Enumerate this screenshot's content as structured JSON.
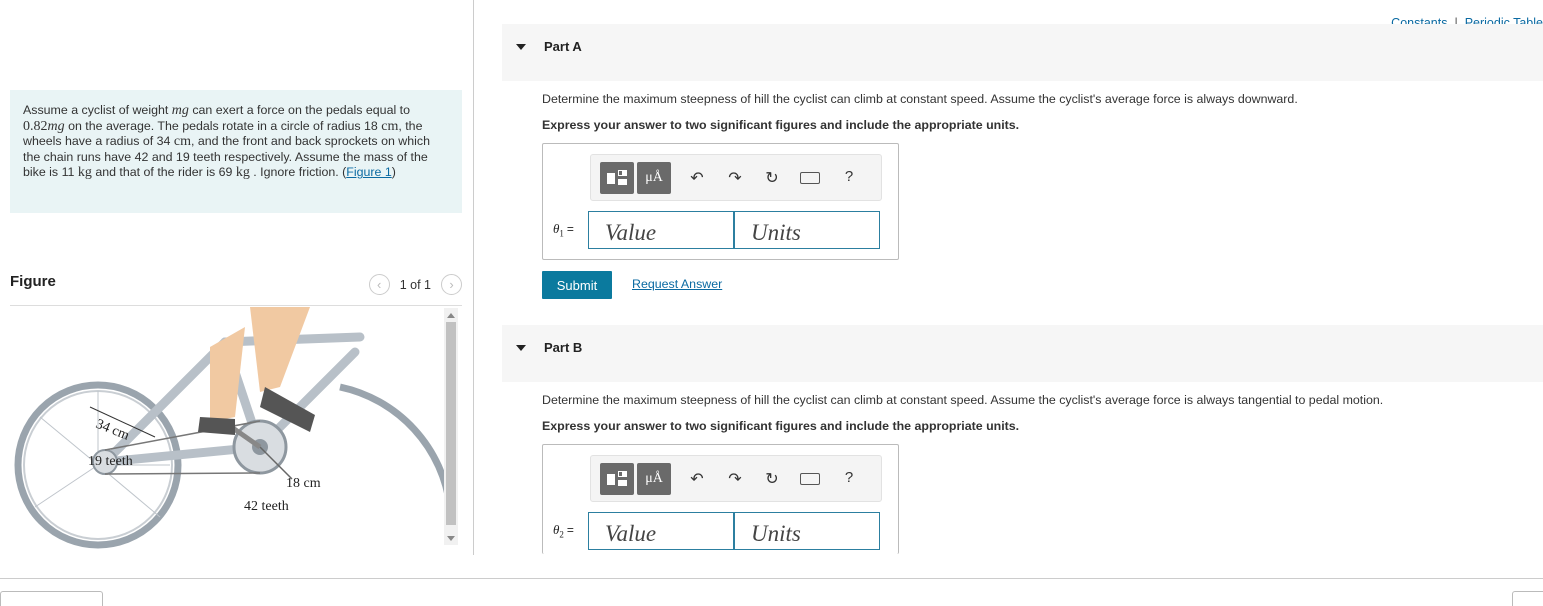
{
  "header": {
    "constants_link": "Constants",
    "separator": "|",
    "periodic_link": "Periodic Table"
  },
  "problem": {
    "t1": "Assume a cyclist of weight ",
    "mg1": "mg",
    "t2": " can exert a force on the pedals equal to ",
    "coef": "0.82",
    "mg2": "mg",
    "t3": " on the average. The pedals rotate in a circle of radius 18 ",
    "cm1": "cm",
    "t4": ", the wheels have a radius of 34 ",
    "cm2": "cm",
    "t5": ", and the front and back sprockets on which the chain runs have 42 and 19 teeth respectively. Assume the mass of the bike is 11 ",
    "kg1": "kg",
    "t6": " and that of the rider is 69 ",
    "kg2": "kg",
    "t7": " . Ignore friction. (",
    "figure_link": "Figure 1",
    "t8": ")"
  },
  "figure": {
    "title": "Figure",
    "pager_text": "1 of 1",
    "labels": {
      "wheel_radius": "34 cm",
      "rear_teeth": "19 teeth",
      "pedal_radius": "18 cm",
      "front_teeth": "42 teeth"
    }
  },
  "parts": [
    {
      "title": "Part A",
      "question": "Determine the maximum steepness of hill the cyclist can climb at constant speed. Assume the cyclist's average force is always downward.",
      "instruction": "Express your answer to two significant figures and include the appropriate units.",
      "variable": "θ",
      "subscript": "1",
      "equals": "=",
      "value_placeholder": "Value",
      "units_placeholder": "Units",
      "submit_label": "Submit",
      "request_label": "Request Answer"
    },
    {
      "title": "Part B",
      "question": "Determine the maximum steepness of hill the cyclist can climb at constant speed. Assume the cyclist's average force is always tangential to pedal motion.",
      "instruction": "Express your answer to two significant figures and include the appropriate units.",
      "variable": "θ",
      "subscript": "2",
      "equals": "=",
      "value_placeholder": "Value",
      "units_placeholder": "Units"
    }
  ],
  "toolbar": {
    "units_button": "μÅ",
    "undo": "↶",
    "redo": "↷",
    "reset": "↻",
    "keyboard": "⌨",
    "help": "?"
  },
  "icons": {
    "pager_prev": "chevron-left-icon",
    "pager_next": "chevron-right-icon",
    "part_toggle": "caret-down-icon",
    "template": "template-icon",
    "undo": "undo-icon",
    "redo": "redo-icon",
    "reset": "reset-icon",
    "keyboard": "keyboard-icon",
    "help": "help-icon"
  },
  "colors": {
    "accent": "#0b7a9e",
    "link": "#0b6aa2",
    "problem_bg": "#e9f4f5",
    "part_header_bg": "#f6f6f6"
  }
}
